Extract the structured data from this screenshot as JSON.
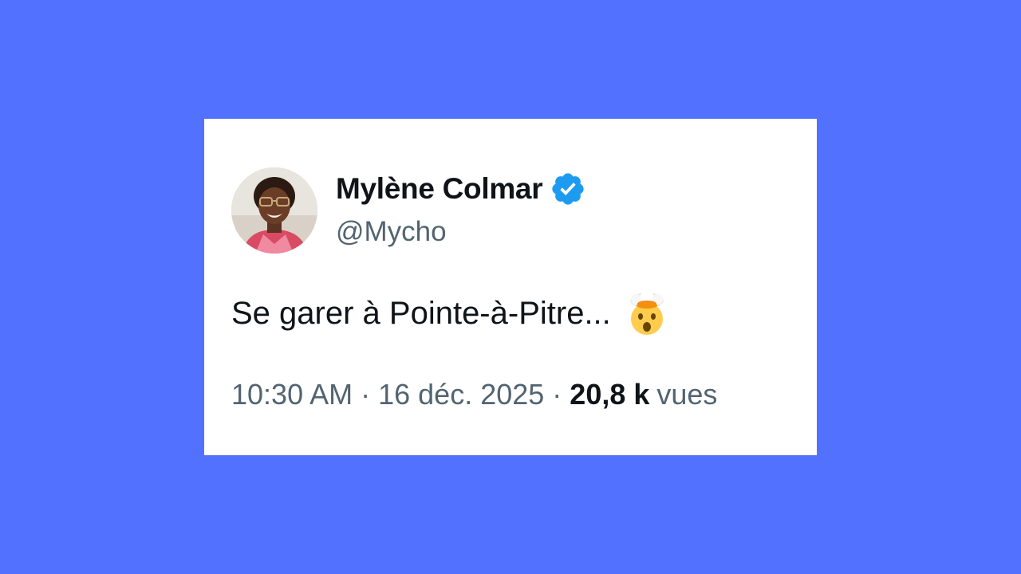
{
  "colors": {
    "background": "#5271ff",
    "card": "#ffffff",
    "name_text": "#0f1419",
    "secondary_text": "#536471",
    "verified_badge": "#1d9bf0"
  },
  "tweet": {
    "author": {
      "display_name": "Mylène Colmar",
      "handle": "@Mycho",
      "verified": true,
      "badge_icon": "verified-badge-icon",
      "avatar_icon": "profile-photo-avatar"
    },
    "text": "Se garer à Pointe-à-Pitre...",
    "emoji_icon": "exploding-head-emoji",
    "time": "10:30 AM",
    "separator": "·",
    "date": "16 déc. 2025",
    "views_count": "20,8 k",
    "views_label": "vues"
  }
}
